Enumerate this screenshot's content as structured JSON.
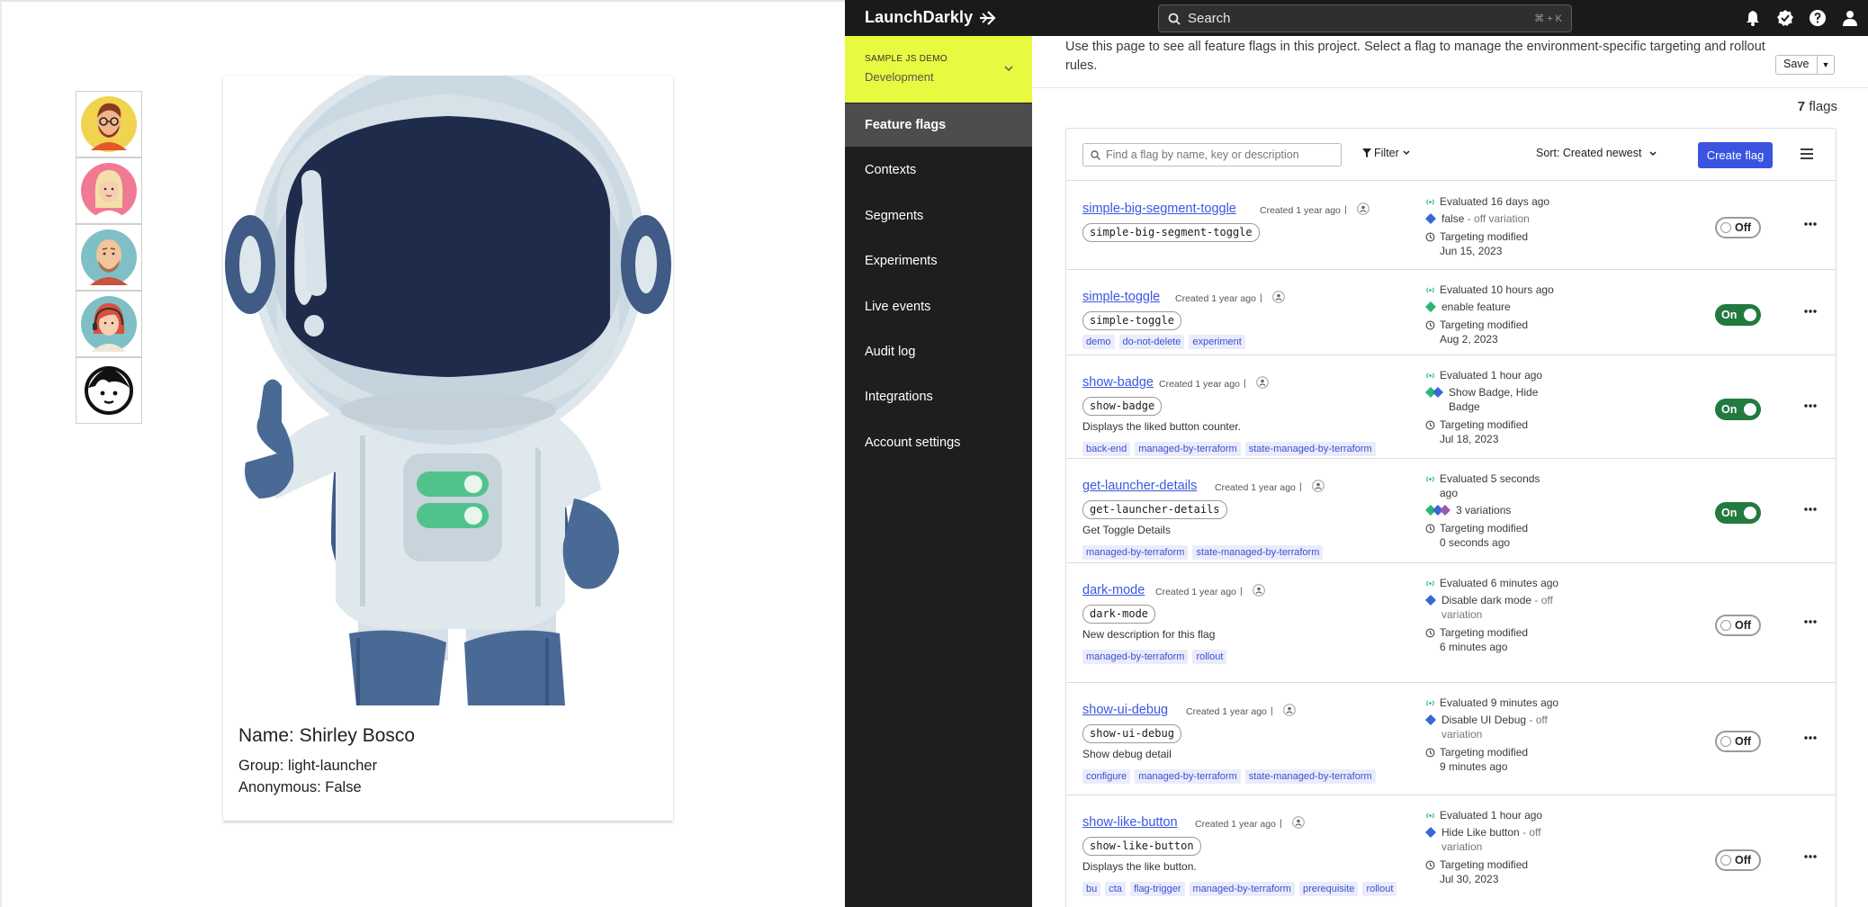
{
  "left_app": {
    "profile": {
      "name": "Name: Shirley Bosco",
      "group": "Group: light-launcher",
      "anonymous": "Anonymous: False"
    },
    "avatars": [
      {
        "icon": "bearded-man-glasses-avatar-icon",
        "color": "#f0d34f"
      },
      {
        "icon": "blonde-woman-avatar-icon",
        "color": "#f07a93"
      },
      {
        "icon": "bald-man-beard-avatar-icon",
        "color": "#7fc0c6"
      },
      {
        "icon": "red-hair-woman-headset-avatar-icon",
        "color": "#7fc0c6"
      },
      {
        "icon": "anonymous-face-avatar-icon",
        "color": "#ffffff"
      }
    ]
  },
  "topbar": {
    "brand": "LaunchDarkly",
    "search_label": "Search",
    "search_shortcut": "⌘ + K"
  },
  "sidebar": {
    "project": "SAMPLE JS DEMO",
    "environment": "Development",
    "env_color": "#e9f940",
    "items": [
      {
        "label": "Feature flags"
      },
      {
        "label": "Contexts"
      },
      {
        "label": "Segments"
      },
      {
        "label": "Experiments"
      },
      {
        "label": "Live events"
      },
      {
        "label": "Audit log"
      },
      {
        "label": "Integrations"
      },
      {
        "label": "Account settings"
      }
    ]
  },
  "main": {
    "intro": "Use this page to see all feature flags in this project. Select a flag to manage the environment-specific targeting and rollout rules.",
    "save_label": "Save",
    "flag_count_num": "7",
    "flag_count_label": "flags",
    "search_placeholder": "Find a flag by name, key or description",
    "filter_label": "Filter",
    "sort_label": "Sort: Created newest",
    "create_label": "Create flag"
  },
  "flags": [
    {
      "name": "simple-big-segment-toggle",
      "created": "Created 1 year ago",
      "key": "simple-big-segment-toggle",
      "description": "",
      "tags": [],
      "evaluated": "Evaluated 16 days ago",
      "variation": "false",
      "variation_suffix": " - off variation",
      "variation_colors": [
        "#3867d6"
      ],
      "targeting_label": "Targeting modified",
      "targeting_date": "Jun 15, 2023",
      "toggle": "Off"
    },
    {
      "name": "simple-toggle",
      "created": "Created 1 year ago",
      "key": "simple-toggle",
      "description": "",
      "tags": [
        "demo",
        "do-not-delete",
        "experiment"
      ],
      "evaluated": "Evaluated 10 hours ago",
      "variation": "enable feature",
      "variation_suffix": "",
      "variation_colors": [
        "#2bb673"
      ],
      "targeting_label": "Targeting modified",
      "targeting_date": "Aug 2, 2023",
      "toggle": "On"
    },
    {
      "name": "show-badge",
      "created": "Created 1 year ago",
      "key": "show-badge",
      "description": "Displays the liked button counter.",
      "tags": [
        "back-end",
        "managed-by-terraform",
        "state-managed-by-terraform"
      ],
      "evaluated": "Evaluated 1 hour ago",
      "variation": "Show Badge, Hide Badge",
      "variation_suffix": "",
      "variation_colors": [
        "#2bb673",
        "#3867d6"
      ],
      "targeting_label": "Targeting modified",
      "targeting_date": "Jul 18, 2023",
      "toggle": "On"
    },
    {
      "name": "get-launcher-details",
      "created": "Created 1 year ago",
      "key": "get-launcher-details",
      "description": "Get Toggle Details",
      "tags": [
        "managed-by-terraform",
        "state-managed-by-terraform"
      ],
      "evaluated": "Evaluated 5 seconds ago",
      "variation": "3 variations",
      "variation_suffix": "",
      "variation_colors": [
        "#2bb673",
        "#3867d6",
        "#9b59b6"
      ],
      "targeting_label": "Targeting modified",
      "targeting_date": "0 seconds ago",
      "toggle": "On"
    },
    {
      "name": "dark-mode",
      "created": "Created 1 year ago",
      "key": "dark-mode",
      "description": "New description for this flag",
      "tags": [
        "managed-by-terraform",
        "rollout"
      ],
      "evaluated": "Evaluated 6 minutes ago",
      "variation": "Disable dark mode",
      "variation_suffix": " - off variation",
      "variation_colors": [
        "#3867d6"
      ],
      "targeting_label": "Targeting modified",
      "targeting_date": "6 minutes ago",
      "toggle": "Off"
    },
    {
      "name": "show-ui-debug",
      "created": "Created 1 year ago",
      "key": "show-ui-debug",
      "description": "Show debug detail",
      "tags": [
        "configure",
        "managed-by-terraform",
        "state-managed-by-terraform"
      ],
      "evaluated": "Evaluated 9 minutes ago",
      "variation": "Disable UI Debug",
      "variation_suffix": " - off variation",
      "variation_colors": [
        "#3867d6"
      ],
      "targeting_label": "Targeting modified",
      "targeting_date": "9 minutes ago",
      "toggle": "Off"
    },
    {
      "name": "show-like-button",
      "created": "Created 1 year ago",
      "key": "show-like-button",
      "description": "Displays the like button.",
      "tags": [
        "bu",
        "cta",
        "flag-trigger",
        "managed-by-terraform",
        "prerequisite",
        "rollout"
      ],
      "evaluated": "Evaluated 1 hour ago",
      "variation": "Hide Like button",
      "variation_suffix": " - off variation",
      "variation_colors": [
        "#3867d6"
      ],
      "targeting_label": "Targeting modified",
      "targeting_date": "Jul 30, 2023",
      "toggle": "Off"
    }
  ]
}
